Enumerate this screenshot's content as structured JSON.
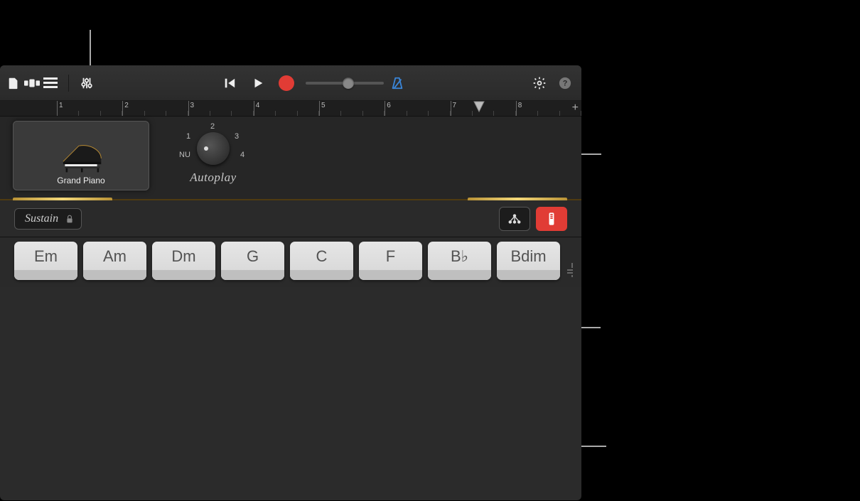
{
  "toolbar": {
    "volume_percent": 55
  },
  "ruler": {
    "measures": [
      1,
      2,
      3,
      4,
      5,
      6,
      7,
      8
    ],
    "playhead_measure": 7.6
  },
  "track": {
    "instrument_label": "Grand Piano"
  },
  "autoplay": {
    "label": "Autoplay",
    "positions": {
      "nu": "NU",
      "p1": "1",
      "p2": "2",
      "p3": "3",
      "p4": "4"
    }
  },
  "sustain": {
    "label": "Sustain"
  },
  "chords": [
    "Em",
    "Am",
    "Dm",
    "G",
    "C",
    "F",
    "B♭",
    "Bdim"
  ]
}
